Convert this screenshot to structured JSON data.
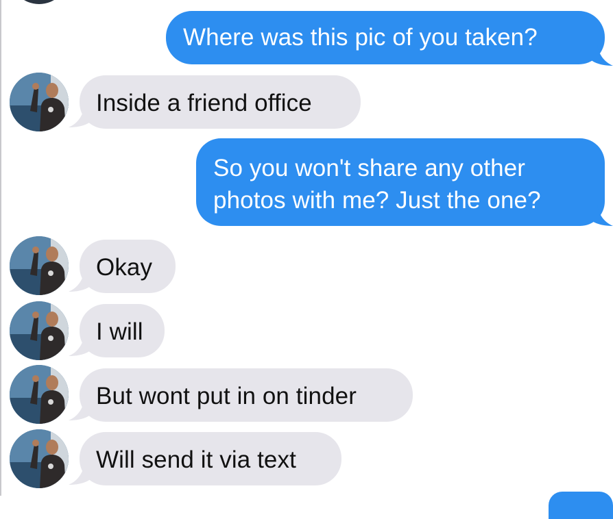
{
  "conversation": {
    "messages": [
      {
        "direction": "outgoing",
        "text": "Where was this pic of you taken?"
      },
      {
        "direction": "incoming",
        "text": "Inside a friend office"
      },
      {
        "direction": "outgoing",
        "lines": [
          "So you won't share any other",
          "photos with me? Just the one?"
        ]
      },
      {
        "direction": "incoming",
        "text": "Okay"
      },
      {
        "direction": "incoming",
        "text": "I will"
      },
      {
        "direction": "incoming",
        "text": "But wont put in on tinder"
      },
      {
        "direction": "incoming",
        "text": "Will send it via text"
      }
    ]
  },
  "contact": {
    "avatar_icon": "contact-photo-avatar"
  },
  "colors": {
    "outgoing_bubble": "#2d8ef0",
    "incoming_bubble": "#e6e5eb",
    "background": "#ffffff"
  }
}
